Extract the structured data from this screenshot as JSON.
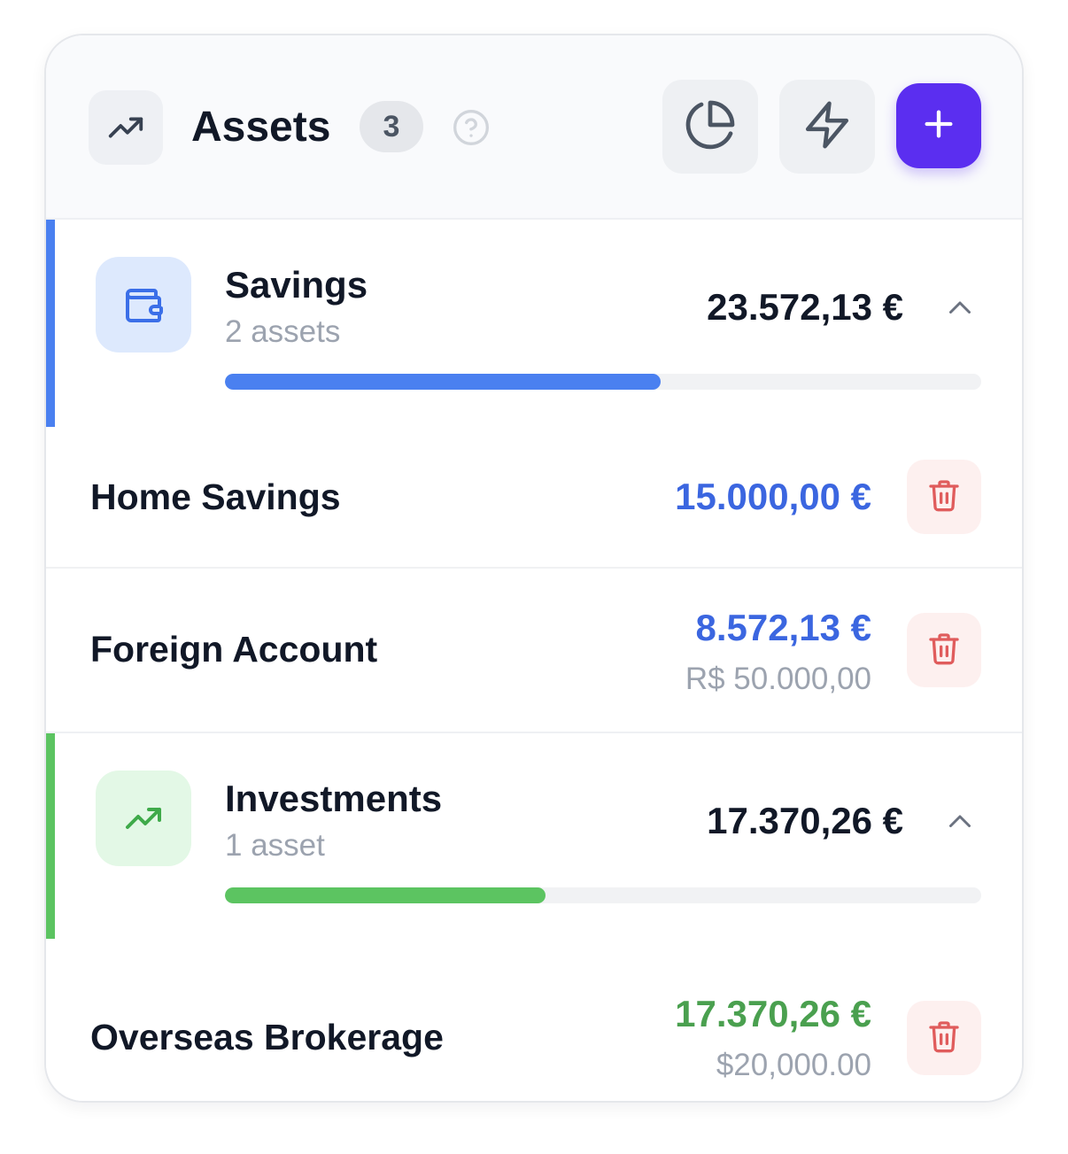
{
  "header": {
    "title": "Assets",
    "count": "3",
    "icons": {
      "trend": "trending-up-icon",
      "help": "help-circle-icon",
      "chart": "pie-chart-icon",
      "bolt": "lightning-icon",
      "add": "plus-icon"
    }
  },
  "colors": {
    "accent": "#5b2ef0",
    "savings": "#4a80f0",
    "investments": "#5cc461",
    "savings_value": "#3b66e0",
    "investments_value": "#4aa04f",
    "delete": "#e05c5c"
  },
  "groups": [
    {
      "name": "Savings",
      "count_label": "2 assets",
      "total": "23.572,13 €",
      "share": 0.576,
      "icon": "wallet-icon",
      "assets": [
        {
          "name": "Home Savings",
          "value": "15.000,00 €",
          "original": ""
        },
        {
          "name": "Foreign Account",
          "value": "8.572,13 €",
          "original": "R$ 50.000,00"
        }
      ]
    },
    {
      "name": "Investments",
      "count_label": "1 asset",
      "total": "17.370,26 €",
      "share": 0.424,
      "icon": "trending-up-icon",
      "assets": [
        {
          "name": "Overseas Brokerage",
          "value": "17.370,26 €",
          "original": "$20,000.00"
        }
      ]
    }
  ]
}
